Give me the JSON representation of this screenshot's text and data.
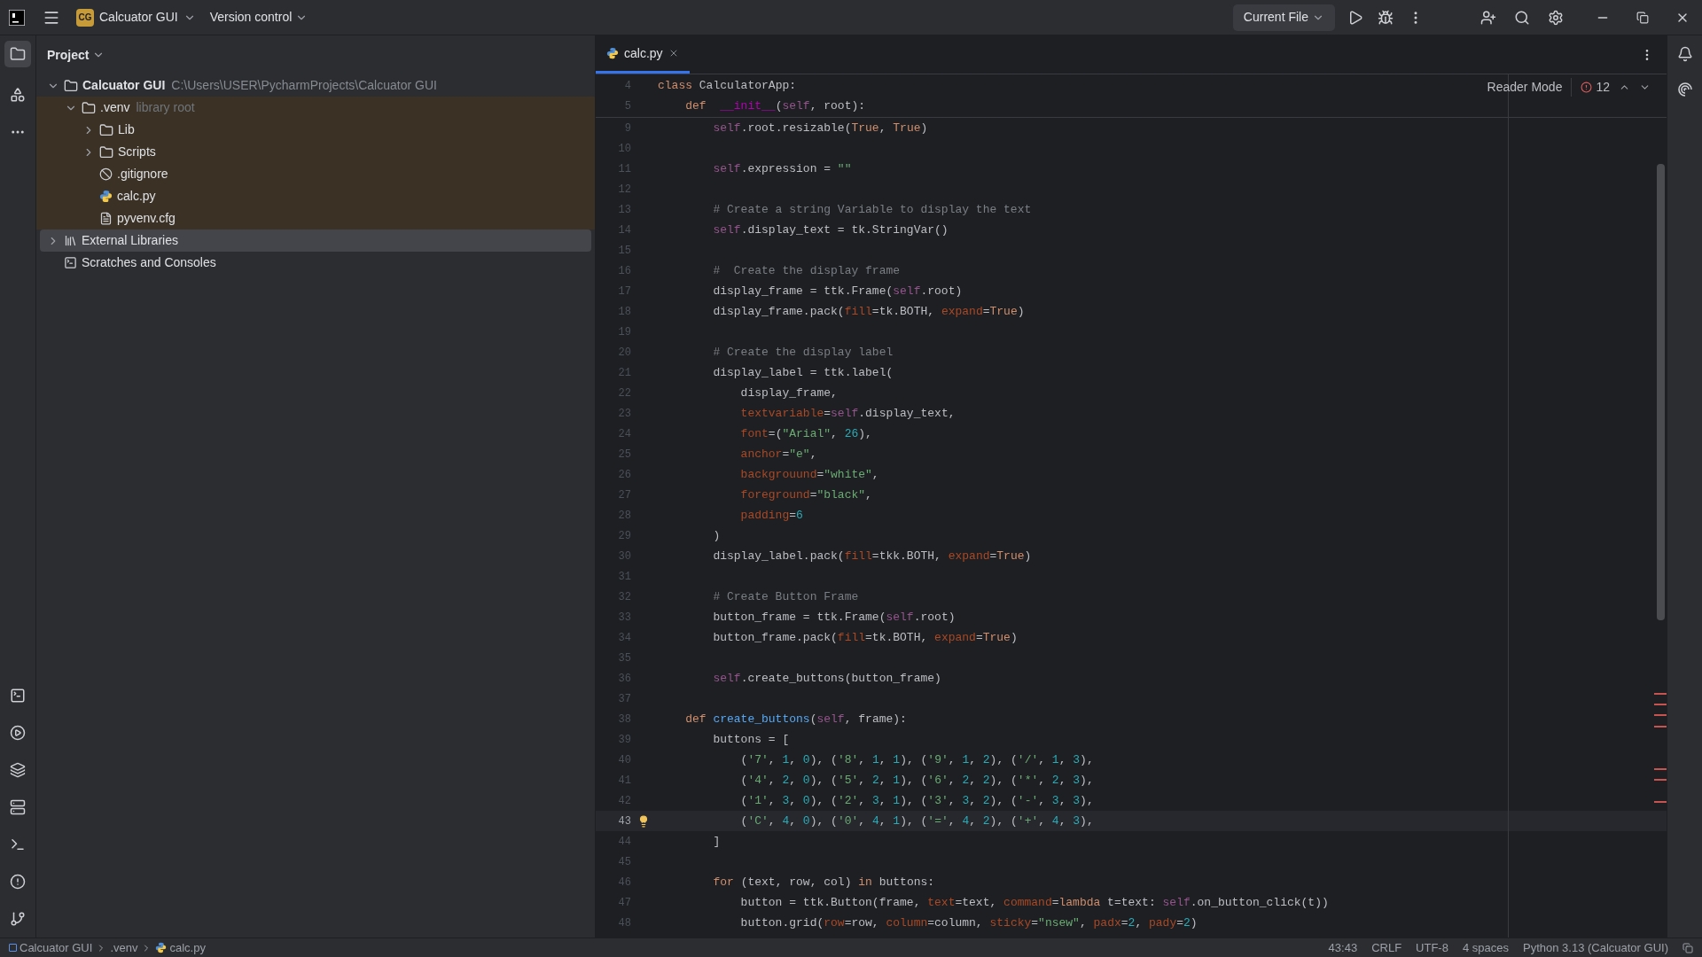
{
  "title_bar": {
    "project_badge": "CG",
    "project": "Calcuator GUI",
    "vcs": "Version control",
    "run_config": "Current File"
  },
  "project_panel": {
    "title": "Project",
    "tree": [
      {
        "name": "Calcuator GUI",
        "path": "C:\\Users\\USER\\PycharmProjects\\Calcuator GUI",
        "kind": "folder",
        "expanded": true,
        "selected": false,
        "highlighted": false,
        "children": [
          {
            "name": ".venv",
            "note": "library root",
            "kind": "folder",
            "expanded": true,
            "selected": false,
            "highlighted": true,
            "children": [
              {
                "name": "Lib",
                "kind": "folder",
                "expanded": false,
                "selected": false,
                "highlighted": true
              },
              {
                "name": "Scripts",
                "kind": "folder",
                "expanded": false,
                "selected": false,
                "highlighted": true
              },
              {
                "name": ".gitignore",
                "kind": "ignored",
                "selected": false,
                "highlighted": true
              },
              {
                "name": "calc.py",
                "kind": "python",
                "selected": false,
                "highlighted": true
              },
              {
                "name": "pyvenv.cfg",
                "kind": "text",
                "selected": false,
                "highlighted": true
              }
            ]
          }
        ]
      },
      {
        "name": "External Libraries",
        "kind": "library",
        "expanded": false,
        "selected": true,
        "highlighted": false
      },
      {
        "name": "Scratches and Consoles",
        "kind": "scratch",
        "selected": false,
        "highlighted": false
      }
    ]
  },
  "editor": {
    "tabs": [
      {
        "label": "calc.py",
        "selected": true
      }
    ],
    "reader_mode": "Reader Mode",
    "problems": "12",
    "sticky_lines": [
      {
        "number": "4",
        "tokens": [
          {
            "text": "class",
            "kind": "kw"
          },
          {
            "text": " CalculatorApp:",
            "kind": "plain"
          }
        ]
      },
      {
        "number": "5",
        "tokens": [
          {
            "text": "    def",
            "kind": "kw"
          },
          {
            "text": "  __init__",
            "kind": "dunder"
          },
          {
            "text": "(",
            "kind": "plain"
          },
          {
            "text": "self",
            "kind": "self"
          },
          {
            "text": ", root):",
            "kind": "plain"
          }
        ]
      }
    ],
    "lines": [
      {
        "number": "9",
        "current": false,
        "tokens": [
          {
            "text": "        self",
            "kind": "self"
          },
          {
            "text": ".root.resizable(",
            "kind": "plain"
          },
          {
            "text": "True",
            "kind": "kw"
          },
          {
            "text": ", ",
            "kind": "plain"
          },
          {
            "text": "True",
            "kind": "kw"
          },
          {
            "text": ")",
            "kind": "plain"
          }
        ]
      },
      {
        "number": "10",
        "current": false
      },
      {
        "number": "11",
        "current": false,
        "tokens": [
          {
            "text": "        self",
            "kind": "self"
          },
          {
            "text": ".expression = ",
            "kind": "plain"
          },
          {
            "text": "\"\"",
            "kind": "str"
          }
        ]
      },
      {
        "number": "12",
        "current": false
      },
      {
        "number": "13",
        "current": false,
        "tokens": [
          {
            "text": "        # Create a string Variable to display the text",
            "kind": "comment"
          }
        ]
      },
      {
        "number": "14",
        "current": false,
        "tokens": [
          {
            "text": "        self",
            "kind": "self"
          },
          {
            "text": ".display_text = tk.StringVar()",
            "kind": "plain"
          }
        ]
      },
      {
        "number": "15",
        "current": false
      },
      {
        "number": "16",
        "current": false,
        "tokens": [
          {
            "text": "        #  Create the display frame",
            "kind": "comment"
          }
        ]
      },
      {
        "number": "17",
        "current": false,
        "tokens": [
          {
            "text": "        display_frame = ttk.Frame(",
            "kind": "plain"
          },
          {
            "text": "self",
            "kind": "self"
          },
          {
            "text": ".root)",
            "kind": "plain"
          }
        ]
      },
      {
        "number": "18",
        "current": false,
        "tokens": [
          {
            "text": "        display_frame.pack(",
            "kind": "plain"
          },
          {
            "text": "fill",
            "kind": "param"
          },
          {
            "text": "=tk.BOTH, ",
            "kind": "plain"
          },
          {
            "text": "expand",
            "kind": "param"
          },
          {
            "text": "=",
            "kind": "plain"
          },
          {
            "text": "True",
            "kind": "kw"
          },
          {
            "text": ")",
            "kind": "plain"
          }
        ]
      },
      {
        "number": "19",
        "current": false
      },
      {
        "number": "20",
        "current": false,
        "tokens": [
          {
            "text": "        # Create the display label",
            "kind": "comment"
          }
        ]
      },
      {
        "number": "21",
        "current": false,
        "tokens": [
          {
            "text": "        display_label = ttk.label(",
            "kind": "plain"
          }
        ]
      },
      {
        "number": "22",
        "current": false,
        "tokens": [
          {
            "text": "            display_frame,",
            "kind": "plain"
          }
        ]
      },
      {
        "number": "23",
        "current": false,
        "tokens": [
          {
            "text": "            textvariable",
            "kind": "param"
          },
          {
            "text": "=",
            "kind": "plain"
          },
          {
            "text": "self",
            "kind": "self"
          },
          {
            "text": ".display_text,",
            "kind": "plain"
          }
        ]
      },
      {
        "number": "24",
        "current": false,
        "tokens": [
          {
            "text": "            font",
            "kind": "param"
          },
          {
            "text": "=(",
            "kind": "plain"
          },
          {
            "text": "\"Arial\"",
            "kind": "str"
          },
          {
            "text": ", ",
            "kind": "plain"
          },
          {
            "text": "26",
            "kind": "num"
          },
          {
            "text": "),",
            "kind": "plain"
          }
        ]
      },
      {
        "number": "25",
        "current": false,
        "tokens": [
          {
            "text": "            anchor",
            "kind": "param"
          },
          {
            "text": "=",
            "kind": "plain"
          },
          {
            "text": "\"e\"",
            "kind": "str"
          },
          {
            "text": ",",
            "kind": "plain"
          }
        ]
      },
      {
        "number": "26",
        "current": false,
        "tokens": [
          {
            "text": "            backgrouund",
            "kind": "param"
          },
          {
            "text": "=",
            "kind": "plain"
          },
          {
            "text": "\"white\"",
            "kind": "str"
          },
          {
            "text": ",",
            "kind": "plain"
          }
        ]
      },
      {
        "number": "27",
        "current": false,
        "tokens": [
          {
            "text": "            foreground",
            "kind": "param"
          },
          {
            "text": "=",
            "kind": "plain"
          },
          {
            "text": "\"black\"",
            "kind": "str"
          },
          {
            "text": ",",
            "kind": "plain"
          }
        ]
      },
      {
        "number": "28",
        "current": false,
        "tokens": [
          {
            "text": "            padding",
            "kind": "param"
          },
          {
            "text": "=",
            "kind": "plain"
          },
          {
            "text": "6",
            "kind": "num"
          }
        ]
      },
      {
        "number": "29",
        "current": false,
        "tokens": [
          {
            "text": "        )",
            "kind": "plain"
          }
        ]
      },
      {
        "number": "30",
        "current": false,
        "tokens": [
          {
            "text": "        display_label.pack(",
            "kind": "plain"
          },
          {
            "text": "fill",
            "kind": "param"
          },
          {
            "text": "=tkk.BOTH, ",
            "kind": "plain"
          },
          {
            "text": "expand",
            "kind": "param"
          },
          {
            "text": "=",
            "kind": "plain"
          },
          {
            "text": "True",
            "kind": "kw"
          },
          {
            "text": ")",
            "kind": "plain"
          }
        ]
      },
      {
        "number": "31",
        "current": false
      },
      {
        "number": "32",
        "current": false,
        "tokens": [
          {
            "text": "        # Create Button Frame",
            "kind": "comment"
          }
        ]
      },
      {
        "number": "33",
        "current": false,
        "tokens": [
          {
            "text": "        button_frame = ttk.Frame(",
            "kind": "plain"
          },
          {
            "text": "self",
            "kind": "self"
          },
          {
            "text": ".root)",
            "kind": "plain"
          }
        ]
      },
      {
        "number": "34",
        "current": false,
        "tokens": [
          {
            "text": "        button_frame.pack(",
            "kind": "plain"
          },
          {
            "text": "fill",
            "kind": "param"
          },
          {
            "text": "=tk.BOTH, ",
            "kind": "plain"
          },
          {
            "text": "expand",
            "kind": "param"
          },
          {
            "text": "=",
            "kind": "plain"
          },
          {
            "text": "True",
            "kind": "kw"
          },
          {
            "text": ")",
            "kind": "plain"
          }
        ]
      },
      {
        "number": "35",
        "current": false
      },
      {
        "number": "36",
        "current": false,
        "tokens": [
          {
            "text": "        self",
            "kind": "self"
          },
          {
            "text": ".create_buttons(button_frame)",
            "kind": "plain"
          }
        ]
      },
      {
        "number": "37",
        "current": false
      },
      {
        "number": "38",
        "current": false,
        "tokens": [
          {
            "text": "    def",
            "kind": "kw"
          },
          {
            "text": " create_buttons",
            "kind": "fn"
          },
          {
            "text": "(",
            "kind": "plain"
          },
          {
            "text": "self",
            "kind": "self"
          },
          {
            "text": ", frame):",
            "kind": "plain"
          }
        ]
      },
      {
        "number": "39",
        "current": false,
        "tokens": [
          {
            "text": "        buttons = [",
            "kind": "plain"
          }
        ]
      },
      {
        "number": "40",
        "current": false,
        "tokens": [
          {
            "text": "            (",
            "kind": "plain"
          },
          {
            "text": "'7'",
            "kind": "str"
          },
          {
            "text": ", ",
            "kind": "plain"
          },
          {
            "text": "1",
            "kind": "num"
          },
          {
            "text": ", ",
            "kind": "plain"
          },
          {
            "text": "0",
            "kind": "num"
          },
          {
            "text": "), (",
            "kind": "plain"
          },
          {
            "text": "'8'",
            "kind": "str"
          },
          {
            "text": ", ",
            "kind": "plain"
          },
          {
            "text": "1",
            "kind": "num"
          },
          {
            "text": ", ",
            "kind": "plain"
          },
          {
            "text": "1",
            "kind": "num"
          },
          {
            "text": "), (",
            "kind": "plain"
          },
          {
            "text": "'9'",
            "kind": "str"
          },
          {
            "text": ", ",
            "kind": "plain"
          },
          {
            "text": "1",
            "kind": "num"
          },
          {
            "text": ", ",
            "kind": "plain"
          },
          {
            "text": "2",
            "kind": "num"
          },
          {
            "text": "), (",
            "kind": "plain"
          },
          {
            "text": "'/'",
            "kind": "str"
          },
          {
            "text": ", ",
            "kind": "plain"
          },
          {
            "text": "1",
            "kind": "num"
          },
          {
            "text": ", ",
            "kind": "plain"
          },
          {
            "text": "3",
            "kind": "num"
          },
          {
            "text": "),",
            "kind": "plain"
          }
        ]
      },
      {
        "number": "41",
        "current": false,
        "tokens": [
          {
            "text": "            (",
            "kind": "plain"
          },
          {
            "text": "'4'",
            "kind": "str"
          },
          {
            "text": ", ",
            "kind": "plain"
          },
          {
            "text": "2",
            "kind": "num"
          },
          {
            "text": ", ",
            "kind": "plain"
          },
          {
            "text": "0",
            "kind": "num"
          },
          {
            "text": "), (",
            "kind": "plain"
          },
          {
            "text": "'5'",
            "kind": "str"
          },
          {
            "text": ", ",
            "kind": "plain"
          },
          {
            "text": "2",
            "kind": "num"
          },
          {
            "text": ", ",
            "kind": "plain"
          },
          {
            "text": "1",
            "kind": "num"
          },
          {
            "text": "), (",
            "kind": "plain"
          },
          {
            "text": "'6'",
            "kind": "str"
          },
          {
            "text": ", ",
            "kind": "plain"
          },
          {
            "text": "2",
            "kind": "num"
          },
          {
            "text": ", ",
            "kind": "plain"
          },
          {
            "text": "2",
            "kind": "num"
          },
          {
            "text": "), (",
            "kind": "plain"
          },
          {
            "text": "'*'",
            "kind": "str"
          },
          {
            "text": ", ",
            "kind": "plain"
          },
          {
            "text": "2",
            "kind": "num"
          },
          {
            "text": ", ",
            "kind": "plain"
          },
          {
            "text": "3",
            "kind": "num"
          },
          {
            "text": "),",
            "kind": "plain"
          }
        ]
      },
      {
        "number": "42",
        "current": false,
        "tokens": [
          {
            "text": "            (",
            "kind": "plain"
          },
          {
            "text": "'1'",
            "kind": "str"
          },
          {
            "text": ", ",
            "kind": "plain"
          },
          {
            "text": "3",
            "kind": "num"
          },
          {
            "text": ", ",
            "kind": "plain"
          },
          {
            "text": "0",
            "kind": "num"
          },
          {
            "text": "), (",
            "kind": "plain"
          },
          {
            "text": "'2'",
            "kind": "str"
          },
          {
            "text": ", ",
            "kind": "plain"
          },
          {
            "text": "3",
            "kind": "num"
          },
          {
            "text": ", ",
            "kind": "plain"
          },
          {
            "text": "1",
            "kind": "num"
          },
          {
            "text": "), (",
            "kind": "plain"
          },
          {
            "text": "'3'",
            "kind": "str"
          },
          {
            "text": ", ",
            "kind": "plain"
          },
          {
            "text": "3",
            "kind": "num"
          },
          {
            "text": ", ",
            "kind": "plain"
          },
          {
            "text": "2",
            "kind": "num"
          },
          {
            "text": "), (",
            "kind": "plain"
          },
          {
            "text": "'-'",
            "kind": "str"
          },
          {
            "text": ", ",
            "kind": "plain"
          },
          {
            "text": "3",
            "kind": "num"
          },
          {
            "text": ", ",
            "kind": "plain"
          },
          {
            "text": "3",
            "kind": "num"
          },
          {
            "text": "),",
            "kind": "plain"
          }
        ]
      },
      {
        "number": "43",
        "current": true,
        "tokens": [
          {
            "text": "            (",
            "kind": "plain"
          },
          {
            "text": "'C'",
            "kind": "str"
          },
          {
            "text": ", ",
            "kind": "plain"
          },
          {
            "text": "4",
            "kind": "num"
          },
          {
            "text": ", ",
            "kind": "plain"
          },
          {
            "text": "0",
            "kind": "num"
          },
          {
            "text": "), (",
            "kind": "plain"
          },
          {
            "text": "'0'",
            "kind": "str"
          },
          {
            "text": ", ",
            "kind": "plain"
          },
          {
            "text": "4",
            "kind": "num"
          },
          {
            "text": ", ",
            "kind": "plain"
          },
          {
            "text": "1",
            "kind": "num"
          },
          {
            "text": "), (",
            "kind": "plain"
          },
          {
            "text": "'='",
            "kind": "str"
          },
          {
            "text": ", ",
            "kind": "plain"
          },
          {
            "text": "4",
            "kind": "num"
          },
          {
            "text": ", ",
            "kind": "plain"
          },
          {
            "text": "2",
            "kind": "num"
          },
          {
            "text": "), (",
            "kind": "plain"
          },
          {
            "text": "'+'",
            "kind": "str"
          },
          {
            "text": ", ",
            "kind": "plain"
          },
          {
            "text": "4",
            "kind": "num"
          },
          {
            "text": ", ",
            "kind": "plain"
          },
          {
            "text": "3",
            "kind": "num"
          },
          {
            "text": "),",
            "kind": "plain"
          }
        ]
      },
      {
        "number": "44",
        "current": false,
        "tokens": [
          {
            "text": "        ]",
            "kind": "plain"
          }
        ]
      },
      {
        "number": "45",
        "current": false
      },
      {
        "number": "46",
        "current": false,
        "tokens": [
          {
            "text": "        for",
            "kind": "kw"
          },
          {
            "text": " (text, row, col) ",
            "kind": "plain"
          },
          {
            "text": "in",
            "kind": "kw"
          },
          {
            "text": " buttons:",
            "kind": "plain"
          }
        ]
      },
      {
        "number": "47",
        "current": false,
        "tokens": [
          {
            "text": "            button = ttk.Button(frame, ",
            "kind": "plain"
          },
          {
            "text": "text",
            "kind": "param"
          },
          {
            "text": "=text, ",
            "kind": "plain"
          },
          {
            "text": "command",
            "kind": "param"
          },
          {
            "text": "=",
            "kind": "plain"
          },
          {
            "text": "lambda",
            "kind": "kw"
          },
          {
            "text": " t=text: ",
            "kind": "plain"
          },
          {
            "text": "self",
            "kind": "self"
          },
          {
            "text": ".on_button_click(t))",
            "kind": "plain"
          }
        ]
      },
      {
        "number": "48",
        "current": false,
        "tokens": [
          {
            "text": "            button.grid(",
            "kind": "plain"
          },
          {
            "text": "row",
            "kind": "param"
          },
          {
            "text": "=row, ",
            "kind": "plain"
          },
          {
            "text": "column",
            "kind": "param"
          },
          {
            "text": "=column, ",
            "kind": "plain"
          },
          {
            "text": "sticky",
            "kind": "param"
          },
          {
            "text": "=",
            "kind": "plain"
          },
          {
            "text": "\"nsew\"",
            "kind": "str"
          },
          {
            "text": ", ",
            "kind": "plain"
          },
          {
            "text": "padx",
            "kind": "param"
          },
          {
            "text": "=",
            "kind": "plain"
          },
          {
            "text": "2",
            "kind": "num"
          },
          {
            "text": ", ",
            "kind": "plain"
          },
          {
            "text": "pady",
            "kind": "param"
          },
          {
            "text": "=",
            "kind": "plain"
          },
          {
            "text": "2",
            "kind": "num"
          },
          {
            "text": ")",
            "kind": "plain"
          }
        ]
      }
    ]
  },
  "status_bar": {
    "breadcrumbs": [
      {
        "label": "Calcuator GUI",
        "kind": "module"
      },
      {
        "label": ".venv",
        "kind": "plain"
      },
      {
        "label": "calc.py",
        "kind": "python"
      }
    ],
    "items": [
      "43:43",
      "CRLF",
      "UTF-8",
      "4 spaces",
      "Python 3.13 (Calcuator GUI)"
    ]
  }
}
